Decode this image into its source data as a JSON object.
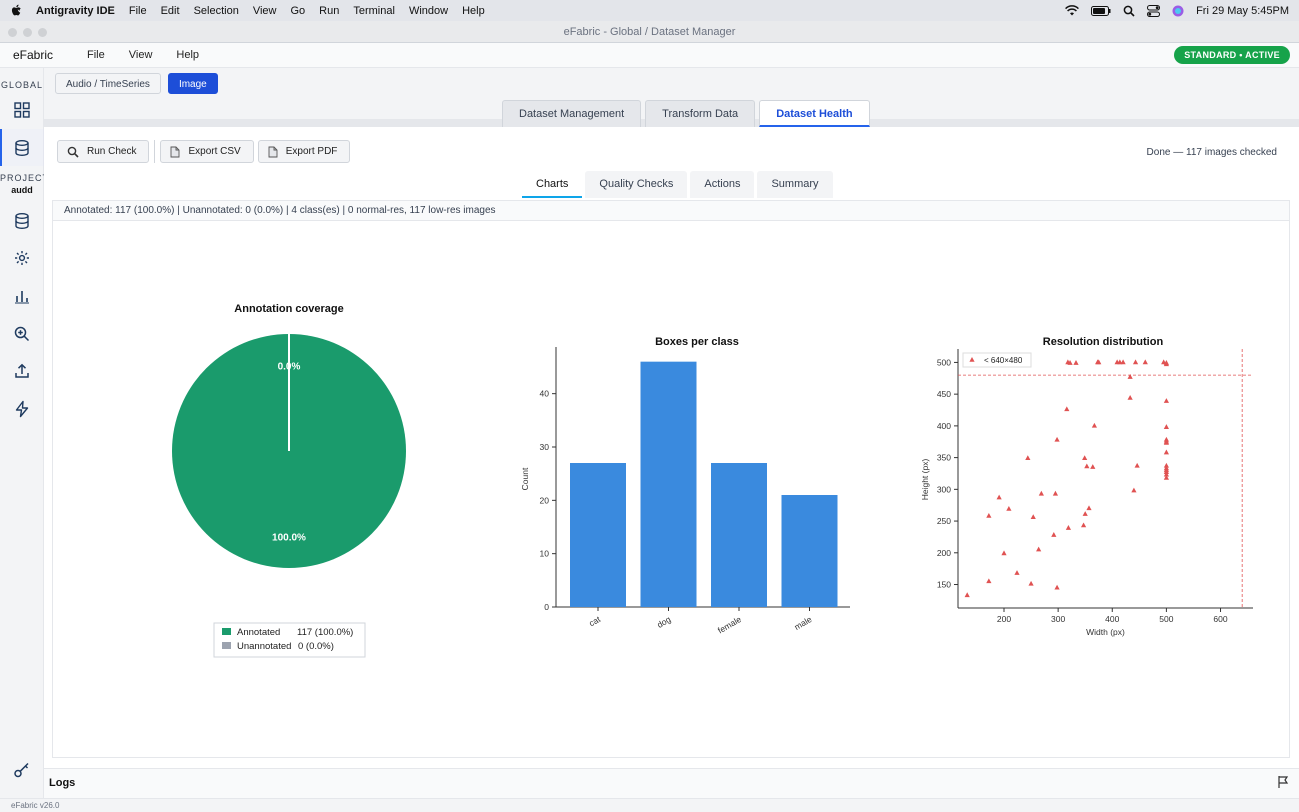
{
  "menubar": {
    "app_name": "Antigravity IDE",
    "items": [
      "File",
      "Edit",
      "Selection",
      "View",
      "Go",
      "Run",
      "Terminal",
      "Window",
      "Help"
    ],
    "clock": "Fri 29 May  5:45PM"
  },
  "window": {
    "title": "eFabric - Global / Dataset Manager"
  },
  "appmenu": {
    "brand": "eFabric",
    "items": [
      "File",
      "View",
      "Help"
    ],
    "license_badge": "STANDARD • ACTIVE"
  },
  "sidebar": {
    "global_label": "GLOBAL",
    "project_label": "PROJECT",
    "project_name": "audd",
    "icons": [
      "grid-icon",
      "database-icon",
      "database-icon",
      "settings-icon",
      "bar-chart-icon",
      "zoom-in-icon",
      "upload-icon",
      "lightning-icon",
      "key-icon"
    ]
  },
  "domain_tabs": [
    {
      "label": "Audio / TimeSeries",
      "active": false
    },
    {
      "label": "Image",
      "active": true
    }
  ],
  "main_tabs": [
    {
      "label": "Dataset Management",
      "active": false
    },
    {
      "label": "Transform Data",
      "active": false
    },
    {
      "label": "Dataset Health",
      "active": true
    }
  ],
  "toolbar": {
    "run_check": "Run Check",
    "export_csv": "Export CSV",
    "export_pdf": "Export PDF"
  },
  "status": "Done — 117 images checked",
  "sub_tabs": [
    {
      "label": "Charts",
      "active": true
    },
    {
      "label": "Quality Checks",
      "active": false
    },
    {
      "label": "Actions",
      "active": false
    },
    {
      "label": "Summary",
      "active": false
    }
  ],
  "infobar": "Annotated: 117 (100.0%)   |   Unannotated: 0 (0.0%)   |   4 class(es)   |   0 normal-res,  117 low-res images",
  "chart_data": [
    {
      "type": "pie",
      "title": "Annotation coverage",
      "slices": [
        {
          "label": "Annotated",
          "value": 117,
          "pct_label": "100.0%",
          "color": "#1a9b6c"
        },
        {
          "label": "Unannotated",
          "value": 0,
          "pct_label": "0.0%",
          "color": "#9ca3af"
        }
      ],
      "legend": [
        {
          "label": "Annotated",
          "value_text": "117  (100.0%)"
        },
        {
          "label": "Unannotated",
          "value_text": "0  (0.0%)"
        }
      ],
      "legend_position": "bottom"
    },
    {
      "type": "bar",
      "title": "Boxes per class",
      "categories": [
        "cat",
        "dog",
        "female",
        "male"
      ],
      "values": [
        27,
        46,
        27,
        21
      ],
      "ylabel": "Count",
      "yticks": [
        "0",
        "10",
        "20",
        "30",
        "40"
      ],
      "ylim": [
        0,
        48
      ],
      "color": "#3a8ade"
    },
    {
      "type": "scatter",
      "title": "Resolution distribution",
      "xlabel": "Width (px)",
      "ylabel": "Height (px)",
      "xlim": [
        115,
        660
      ],
      "ylim": [
        113,
        518
      ],
      "xticks": [
        "200",
        "300",
        "400",
        "500",
        "600"
      ],
      "yticks": [
        "150",
        "200",
        "250",
        "300",
        "350",
        "400",
        "450",
        "500"
      ],
      "legend": "< 640×480",
      "legend_position": "top-left",
      "color": "#e05252",
      "threshold_x": 640,
      "threshold_y": 480,
      "points": [
        [
          318,
          500
        ],
        [
          322,
          499
        ],
        [
          333,
          499
        ],
        [
          373,
          500
        ],
        [
          375,
          500
        ],
        [
          409,
          500
        ],
        [
          414,
          500
        ],
        [
          420,
          500
        ],
        [
          443,
          500
        ],
        [
          461,
          500
        ],
        [
          495,
          500
        ],
        [
          500,
          499
        ],
        [
          500,
          497
        ],
        [
          433,
          477
        ],
        [
          433,
          444
        ],
        [
          500,
          439
        ],
        [
          316,
          426
        ],
        [
          367,
          400
        ],
        [
          500,
          398
        ],
        [
          298,
          378
        ],
        [
          500,
          378
        ],
        [
          500,
          375
        ],
        [
          500,
          373
        ],
        [
          500,
          358
        ],
        [
          244,
          349
        ],
        [
          349,
          349
        ],
        [
          353,
          336
        ],
        [
          364,
          335
        ],
        [
          446,
          337
        ],
        [
          500,
          337
        ],
        [
          500,
          333
        ],
        [
          500,
          330
        ],
        [
          500,
          327
        ],
        [
          500,
          323
        ],
        [
          500,
          318
        ],
        [
          269,
          293
        ],
        [
          295,
          293
        ],
        [
          440,
          298
        ],
        [
          191,
          287
        ],
        [
          209,
          269
        ],
        [
          357,
          270
        ],
        [
          172,
          258
        ],
        [
          254,
          256
        ],
        [
          350,
          261
        ],
        [
          347,
          243
        ],
        [
          319,
          239
        ],
        [
          292,
          228
        ],
        [
          264,
          205
        ],
        [
          200,
          199
        ],
        [
          224,
          168
        ],
        [
          172,
          155
        ],
        [
          250,
          151
        ],
        [
          298,
          145
        ],
        [
          132,
          133
        ]
      ]
    }
  ],
  "logs": {
    "title": "Logs"
  },
  "footer": {
    "version": "eFabric v26.0"
  }
}
